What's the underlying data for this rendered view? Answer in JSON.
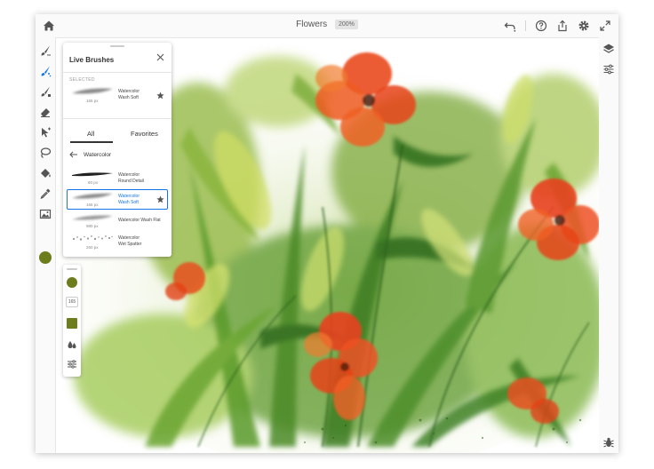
{
  "header": {
    "title": "Flowers",
    "zoom": "200%",
    "icons": [
      "home-icon",
      "undo-icon",
      "help-icon",
      "share-icon",
      "settings-icon",
      "fullscreen-icon"
    ]
  },
  "left_toolbar": {
    "tools": [
      "paint-brush-icon",
      "live-brush-icon",
      "pixel-brush-icon",
      "eraser-icon",
      "transform-icon",
      "lasso-icon",
      "fill-icon",
      "eyedropper-icon",
      "image-icon"
    ],
    "active_tool": "live-brush-icon",
    "color": "#6c7d1d"
  },
  "right_toolbar": {
    "tools": [
      "layers-icon",
      "layer-properties-icon",
      "bug-icon"
    ]
  },
  "panel": {
    "title": "Live Brushes",
    "selected_label": "SELECTED",
    "selected_brush": {
      "name_line1": "Watercolor",
      "name_line2": "Wash Soft",
      "size": "165 px"
    },
    "tabs": [
      {
        "label": "All",
        "active": true
      },
      {
        "label": "Favorites",
        "active": false
      }
    ],
    "category": "Watercolor",
    "brushes": [
      {
        "name_line1": "Watercolor",
        "name_line2": "Round Detail",
        "size": "60 px",
        "active": false
      },
      {
        "name_line1": "Watercolor",
        "name_line2": "Wash Soft",
        "size": "165 px",
        "active": true
      },
      {
        "name_line1": "Watercolor Wash Flat",
        "name_line2": "",
        "size": "980 px",
        "active": false
      },
      {
        "name_line1": "Watercolor",
        "name_line2": "Wet Spatter",
        "size": "260 px",
        "active": false
      }
    ]
  },
  "mini_panel": {
    "color": "#6c7d1d",
    "size": "165"
  },
  "colors": {
    "accent": "#1473e6",
    "brush_green": "#6c7d1d",
    "flower_red": "#e8401c"
  }
}
